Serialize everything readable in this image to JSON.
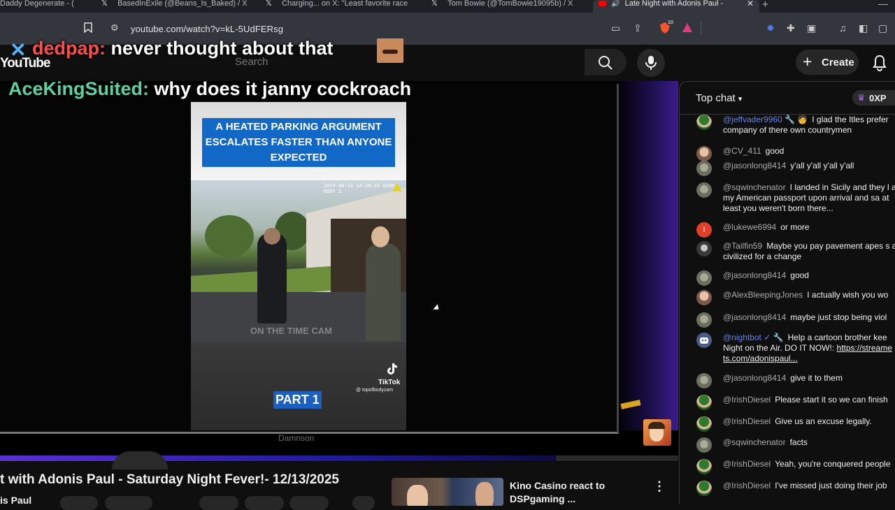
{
  "browser": {
    "tabs": [
      {
        "label": "Daddy Degenerate - (",
        "icon": "x-logo-icon",
        "active": false
      },
      {
        "label": "BasedInExile (@Beans_Is_Baked) / X",
        "icon": "x-logo-icon",
        "active": false
      },
      {
        "label": "Charging... on X: \"Least favorite race",
        "icon": "x-logo-icon",
        "active": false
      },
      {
        "label": "Tom Bowie (@TomBowie19095b) / X",
        "icon": "x-logo-icon",
        "active": false
      },
      {
        "label": "Late Night with Adonis Paul -",
        "icon": "youtube-icon",
        "active": true
      }
    ],
    "url": "youtube.com/watch?v=kL-5UdFERsg",
    "brave_badge": "10"
  },
  "youtube_header": {
    "logo": "YouTube",
    "search_placeholder": "Search",
    "create_label": "Create"
  },
  "overlay_chat": [
    {
      "user": "dedpap:",
      "text": "never thought about that"
    },
    {
      "user": "AceKingSuited:",
      "text": "why does it janny cockroach"
    }
  ],
  "video": {
    "tiktok_headline": "A HEATED PARKING ARGUMENT ESCALATES FASTER THAN ANYONE EXPECTED",
    "watermark": "ON THE TIME CAM",
    "bodycam_stamp": "2024-06-11 14:26:32 AXON BODY 3",
    "tiktok_label": "TikTok",
    "tiktok_handle": "@ topofbodycam",
    "part_label": "PART 1",
    "caption_name": "Damnson",
    "progress": 0.82
  },
  "below_video": {
    "title": "t with Adonis Paul - Saturday Night Fever!- 12/13/2025",
    "channel": "is Paul",
    "recommended": {
      "title": "Kino Casino react to DSPgaming ..."
    }
  },
  "chat": {
    "mode": "Top chat",
    "xp": "0XP",
    "messages": [
      {
        "author": "@jeffvader9960 🔧 🧑",
        "text": "I glad the Itles prefer company of there own countrymen",
        "avatar": "av-green",
        "mod": true
      },
      {
        "author": "@CV_411",
        "text": "good",
        "avatar": "av-face",
        "mod": false
      },
      {
        "author": "@jasonlong8414",
        "text": "y'all y'all y'all y'all",
        "avatar": "av-grey",
        "mod": false
      },
      {
        "author": "@sqwinchenator",
        "text": "I landed in Sicily and they l at my American passport upon arrival and sa at least you weren't born there...",
        "avatar": "av-grey",
        "mod": false
      },
      {
        "author": "@lukewe6994",
        "text": "or more",
        "avatar": "av-red",
        "initial": "l",
        "mod": false
      },
      {
        "author": "@Tailfin59",
        "text": "Maybe you pay pavement apes s act civilized for a change",
        "avatar": "av-dark",
        "mod": false
      },
      {
        "author": "@jasonlong8414",
        "text": "good",
        "avatar": "av-grey",
        "mod": false
      },
      {
        "author": "@AlexBleepingJones",
        "text": "I actually wish you wo",
        "avatar": "av-face",
        "mod": false
      },
      {
        "author": "@jasonlong8414",
        "text": "maybe just stop being viol",
        "avatar": "av-grey",
        "mod": false
      },
      {
        "author": "@nightbot ✓ 🔧",
        "text": "Help a cartoon brother kee Night on the Air. DO IT NOW!:",
        "link": "https://streame ts.com/adonispaul...",
        "avatar": "av-bot",
        "mod": true
      },
      {
        "author": "@jasonlong8414",
        "text": "give it to them",
        "avatar": "av-grey",
        "mod": false
      },
      {
        "author": "@IrishDiesel",
        "text": "Please start it so we can finish",
        "avatar": "av-green",
        "mod": false
      },
      {
        "author": "@IrishDiesel",
        "text": "Give us an excuse legally.",
        "avatar": "av-green",
        "mod": false
      },
      {
        "author": "@sqwinchenator",
        "text": "facts",
        "avatar": "av-grey",
        "mod": false
      },
      {
        "author": "@IrishDiesel",
        "text": "Yeah, you're conquered people",
        "avatar": "av-green",
        "mod": false
      },
      {
        "author": "@IrishDiesel",
        "text": "I've missed just doing their job",
        "avatar": "av-green",
        "mod": false
      }
    ]
  }
}
